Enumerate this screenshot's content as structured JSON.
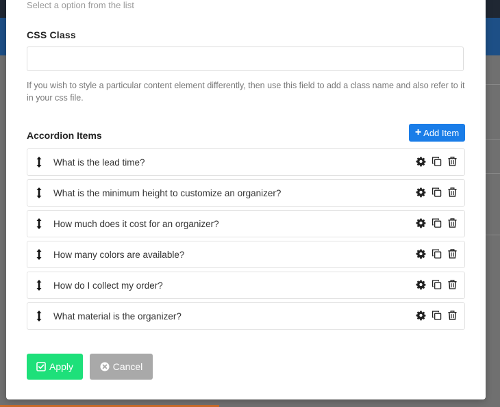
{
  "form": {
    "select_hint": "Select a option from the list",
    "css_class_label": "CSS Class",
    "css_class_value": "",
    "css_class_help": "If you wish to style a particular content element differently, then use this field to add a class name and also refer to it in your css file."
  },
  "accordion": {
    "title": "Accordion Items",
    "add_label": "Add Item",
    "items": [
      {
        "label": "What is the lead time?"
      },
      {
        "label": "What is the minimum height to customize an organizer?"
      },
      {
        "label": "How much does it cost for an organizer?"
      },
      {
        "label": "How many colors are available?"
      },
      {
        "label": "How do I collect my order?"
      },
      {
        "label": "What material is the organizer?"
      }
    ],
    "item_icons": [
      "arrows-vertical-icon",
      "gear-icon",
      "copy-icon",
      "trash-icon"
    ]
  },
  "actions": {
    "apply_label": "Apply",
    "cancel_label": "Cancel"
  },
  "colors": {
    "add_button": "#1a7de8",
    "apply_button": "#1ee07a",
    "cancel_button": "#a9a9a9",
    "header_bar": "#1d4f86"
  }
}
